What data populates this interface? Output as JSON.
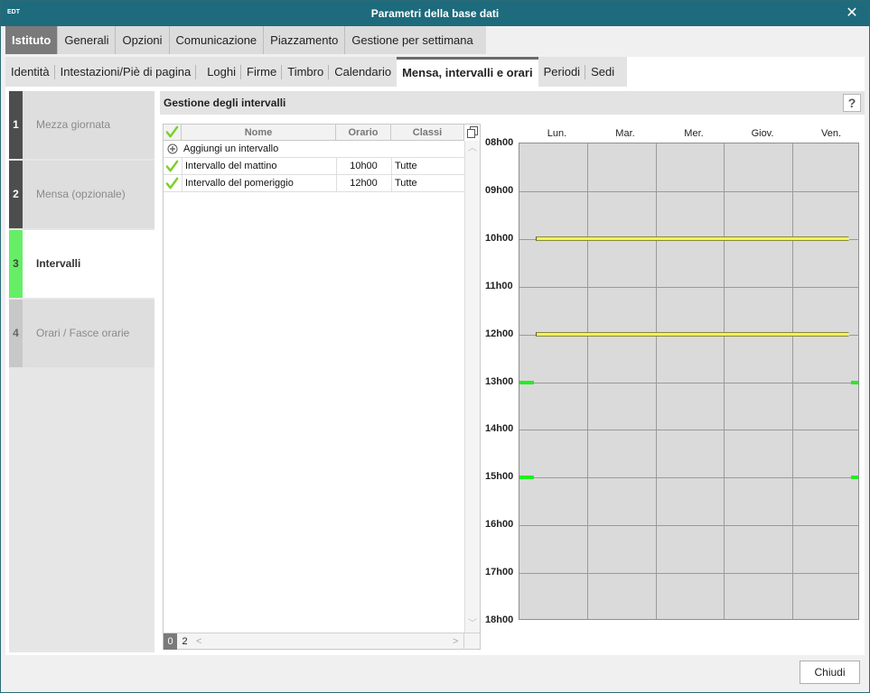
{
  "window": {
    "app_icon_text": "EDT",
    "title": "Parametri della base dati",
    "close_glyph": "✕"
  },
  "main_tabs": [
    "Istituto",
    "Generali",
    "Opzioni",
    "Comunicazione",
    "Piazzamento",
    "Gestione per settimana"
  ],
  "main_tab_active": "Istituto",
  "sub_tabs": [
    "Identità",
    "Intestazioni/Piè di pagina",
    "Loghi",
    "Firme",
    "Timbro",
    "Calendario",
    "Mensa, intervalli e orari",
    "Periodi",
    "Sedi"
  ],
  "sub_tab_active": "Mensa, intervalli e orari",
  "steps": [
    {
      "num": "1",
      "label": "Mezza giornata"
    },
    {
      "num": "2",
      "label": "Mensa (opzionale)"
    },
    {
      "num": "3",
      "label": "Intervalli"
    },
    {
      "num": "4",
      "label": "Orari / Fasce orarie"
    }
  ],
  "step_active": "3",
  "panel": {
    "title": "Gestione degli intervalli",
    "help": "?"
  },
  "table": {
    "columns": [
      "Nome",
      "Orario",
      "Classi"
    ],
    "add_row_label": "Aggiungi un intervallo",
    "rows": [
      {
        "nome": "Intervallo del mattino",
        "orario": "10h00",
        "classi": "Tutte",
        "checked": true
      },
      {
        "nome": "Intervallo del pomeriggio",
        "orario": "12h00",
        "classi": "Tutte",
        "checked": true
      }
    ],
    "pages": [
      "0",
      "2"
    ]
  },
  "timetable": {
    "days": [
      "Lun.",
      "Mar.",
      "Mer.",
      "Giov.",
      "Ven."
    ],
    "hours": [
      "08h00",
      "09h00",
      "10h00",
      "11h00",
      "12h00",
      "13h00",
      "14h00",
      "15h00",
      "16h00",
      "17h00",
      "18h00"
    ],
    "interval_bars_at_hours": [
      10,
      12
    ],
    "lunch_markers_at_hours": [
      13,
      15
    ],
    "colors": {
      "interval_bar": "#f2f25a",
      "lunch_marker": "#22ee22",
      "active_step": "#66ee66"
    }
  },
  "footer": {
    "close_label": "Chiudi"
  }
}
